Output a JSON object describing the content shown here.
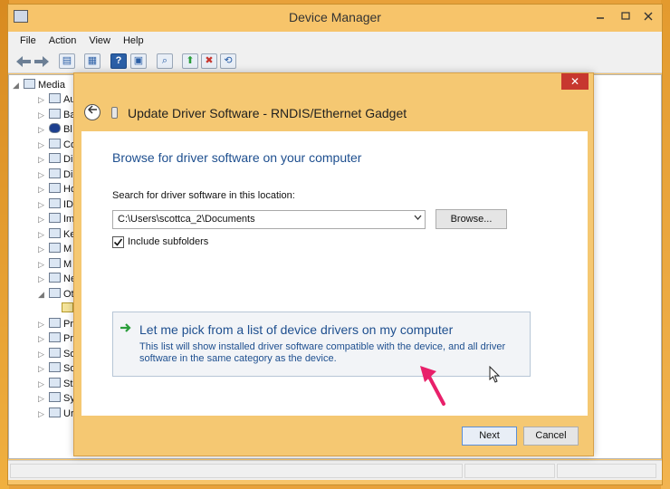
{
  "device_manager": {
    "title": "Device Manager",
    "menu": [
      "File",
      "Action",
      "View",
      "Help"
    ],
    "toolbar_icons": [
      "back-icon",
      "forward-icon",
      "show-hide-tree-icon",
      "properties-icon",
      "help-icon",
      "action-pane-icon",
      "scan-hardware-icon",
      "update-driver-icon",
      "uninstall-icon",
      "enable-device-icon"
    ],
    "tree": [
      {
        "label": "Media",
        "arrow": "◢",
        "icon": "computer-icon"
      },
      {
        "label": "Au",
        "arrow": "▷",
        "icon": "audio-icon"
      },
      {
        "label": "Ba",
        "arrow": "▷",
        "icon": "battery-icon"
      },
      {
        "label": "Bl",
        "arrow": "▷",
        "icon": "bluetooth-icon"
      },
      {
        "label": "Co",
        "arrow": "▷",
        "icon": "computer-icon"
      },
      {
        "label": "Di",
        "arrow": "▷",
        "icon": "disk-drive-icon"
      },
      {
        "label": "Di",
        "arrow": "▷",
        "icon": "display-adapter-icon"
      },
      {
        "label": "Ho",
        "arrow": "▷",
        "icon": "hid-icon"
      },
      {
        "label": "ID",
        "arrow": "▷",
        "icon": "ide-controller-icon"
      },
      {
        "label": "Im",
        "arrow": "▷",
        "icon": "imaging-device-icon"
      },
      {
        "label": "Ke",
        "arrow": "▷",
        "icon": "keyboard-icon"
      },
      {
        "label": "M",
        "arrow": "▷",
        "icon": "mouse-icon"
      },
      {
        "label": "M",
        "arrow": "▷",
        "icon": "monitor-icon"
      },
      {
        "label": "Ne",
        "arrow": "▷",
        "icon": "network-adapter-icon"
      },
      {
        "label": "Ot",
        "arrow": "◢",
        "icon": "other-devices-icon"
      },
      {
        "label": "",
        "arrow": "",
        "icon": "unknown-device-icon"
      },
      {
        "label": "Pr",
        "arrow": "▷",
        "icon": "printer-icon"
      },
      {
        "label": "Pr",
        "arrow": "▷",
        "icon": "processor-icon"
      },
      {
        "label": "So",
        "arrow": "▷",
        "icon": "software-device-icon"
      },
      {
        "label": "So",
        "arrow": "▷",
        "icon": "sound-icon"
      },
      {
        "label": "St",
        "arrow": "▷",
        "icon": "storage-controller-icon"
      },
      {
        "label": "Sy",
        "arrow": "▷",
        "icon": "system-device-icon"
      },
      {
        "label": "Ur",
        "arrow": "▷",
        "icon": "usb-controller-icon"
      }
    ]
  },
  "dialog": {
    "title": "Update Driver Software - RNDIS/Ethernet Gadget",
    "close_glyph": "✕",
    "heading": "Browse for driver software on your computer",
    "search_label": "Search for driver software in this location:",
    "path_value": "C:\\Users\\scottca_2\\Documents",
    "browse_label": "Browse...",
    "include_subfolders_label": "Include subfolders",
    "include_subfolders_checked": true,
    "pick_title": "Let me pick from a list of device drivers on my computer",
    "pick_desc": "This list will show installed driver software compatible with the device, and all driver software in the same category as the device.",
    "next_label": "Next",
    "cancel_label": "Cancel"
  },
  "colors": {
    "accent_link": "#1e4f8f",
    "frame": "#f5c872",
    "close_red": "#c7372f",
    "annotation_arrow": "#e8206a"
  }
}
